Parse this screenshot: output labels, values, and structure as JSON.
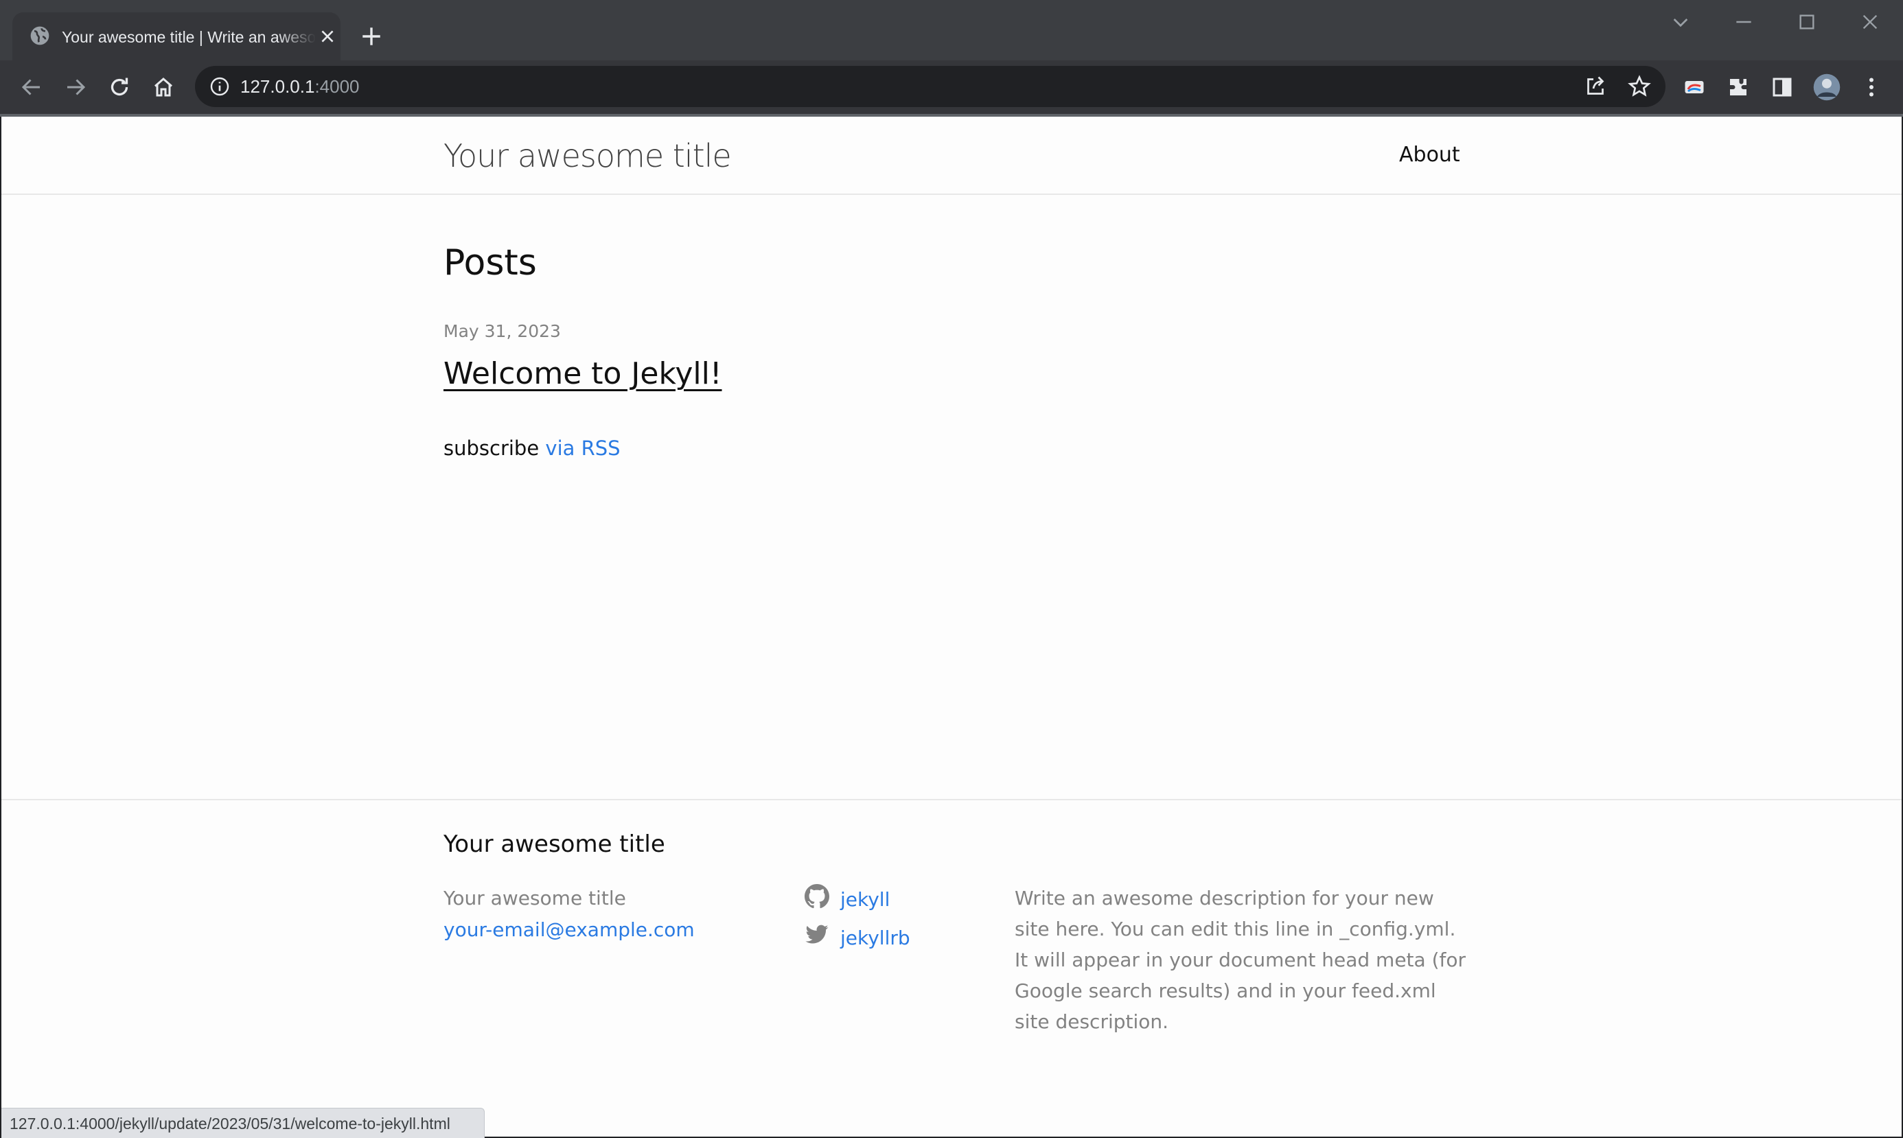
{
  "browser": {
    "tab_title": "Your awesome title | Write an awesome description for your new site here.",
    "url_host": "127.0.0.1",
    "url_port": ":4000",
    "status_url": "127.0.0.1:4000/jekyll/update/2023/05/31/welcome-to-jekyll.html"
  },
  "header": {
    "site_title": "Your awesome title",
    "nav": [
      {
        "label": "About"
      }
    ]
  },
  "main": {
    "heading": "Posts",
    "posts": [
      {
        "date": "May 31, 2023",
        "title": "Welcome to Jekyll!"
      }
    ],
    "subscribe_text": "subscribe",
    "subscribe_link": "via RSS"
  },
  "footer": {
    "heading": "Your awesome title",
    "name": "Your awesome title",
    "email": "your-email@example.com",
    "social": [
      {
        "icon": "github-icon",
        "label": "jekyll"
      },
      {
        "icon": "twitter-icon",
        "label": "jekyllrb"
      }
    ],
    "description": "Write an awesome description for your new site here. You can edit this line in _config.yml. It will appear in your document head meta (for Google search results) and in your feed.xml site description."
  },
  "colors": {
    "link": "#2a7ae2",
    "muted": "#828282",
    "chrome_dark": "#202124",
    "chrome_tab": "#35363a"
  }
}
